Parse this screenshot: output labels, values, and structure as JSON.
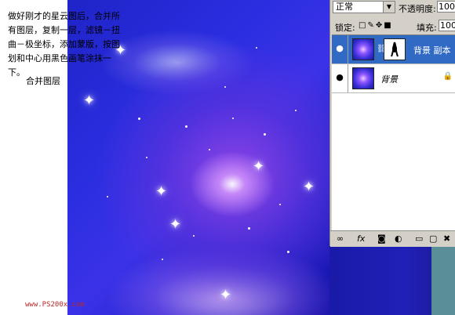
{
  "canvas": {
    "instruction_text": "做好刚才的星云图后，合并所有图层，复制一层，滤镜－扭曲－极坐标，添加蒙版，按图划和中心用黑色画笔涂抹一下。",
    "merge_label": "合并图层",
    "watermark": "www.PS200x.com"
  },
  "layers_panel": {
    "blend_mode": "正常",
    "opacity_label": "不透明度:",
    "opacity_value": "100%",
    "lock_label": "锁定:",
    "fill_label": "填充:",
    "fill_value": "100%",
    "layers": [
      {
        "name": "背景 副本",
        "selected": true,
        "has_mask": true
      },
      {
        "name": "背景",
        "selected": false,
        "has_mask": false,
        "locked": true
      }
    ],
    "bottom_icons": [
      "link-layers-icon",
      "fx-icon",
      "add-mask-icon",
      "adjustment-layer-icon",
      "new-group-icon",
      "new-layer-icon",
      "delete-layer-icon"
    ]
  },
  "colors": {
    "selected_layer": "#316ac5",
    "panel_bg": "#d4d0c8",
    "watermark": "#b5282a"
  }
}
